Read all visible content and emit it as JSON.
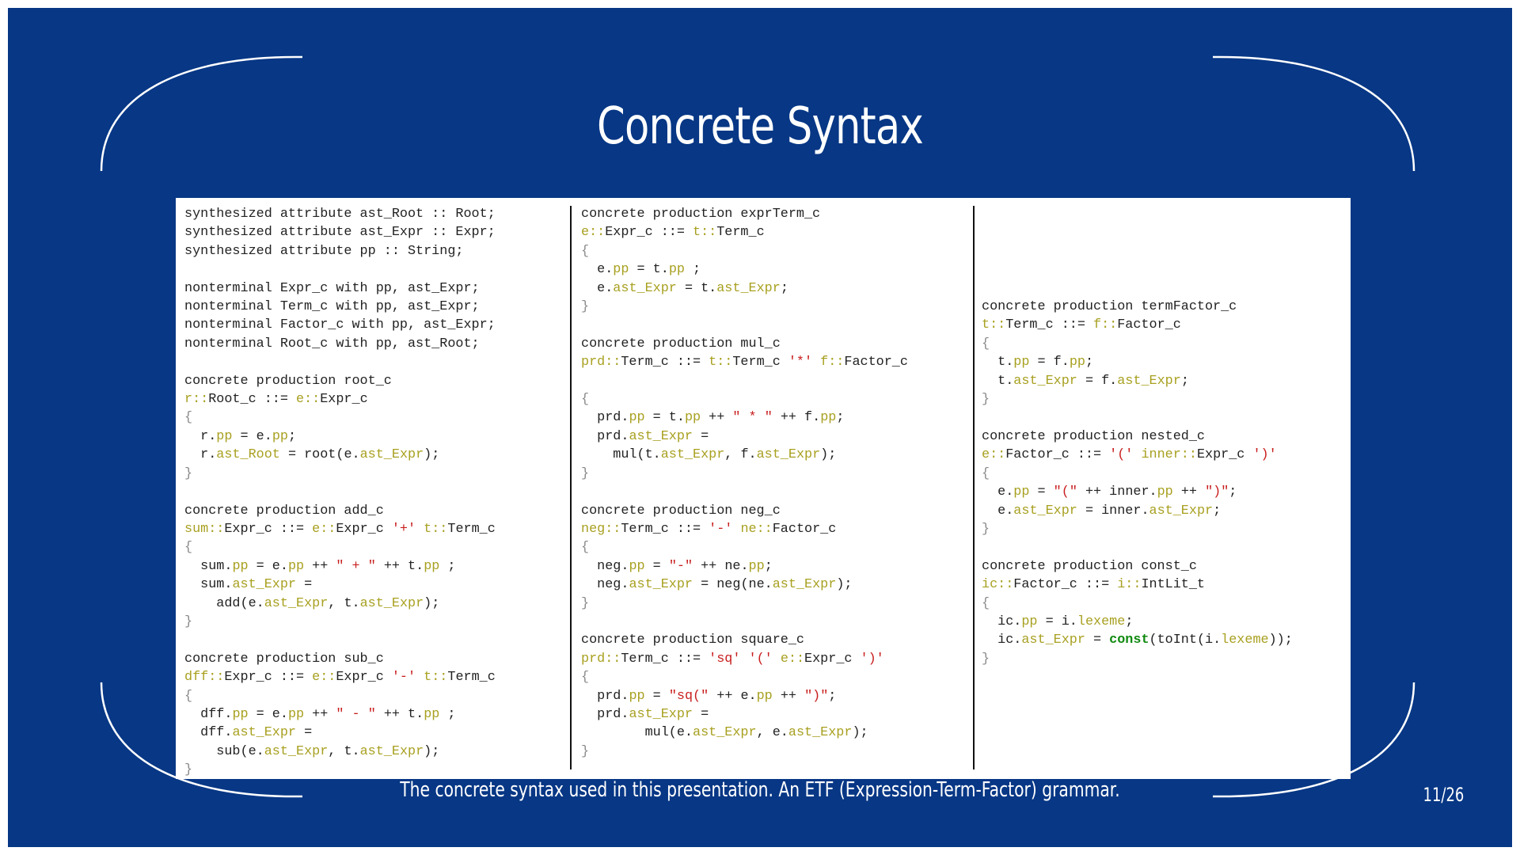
{
  "slide": {
    "title": "Concrete Syntax",
    "caption": "The concrete syntax used in this presentation. An ETF (Expression-Term-Factor) grammar.",
    "page_number": "11/26",
    "background_color": "#073785",
    "frame_color": "#ffffff"
  },
  "code": {
    "colors": {
      "keyword": "#222222",
      "variable": "#a8a020",
      "string": "#c81e1e",
      "brace": "#8a8a8a",
      "constant": "#118a11"
    },
    "columns": [
      [
        [
          [
            "k",
            "synthesized attribute ast_Root :: Root;"
          ]
        ],
        [
          [
            "k",
            "synthesized attribute ast_Expr :: Expr;"
          ]
        ],
        [
          [
            "k",
            "synthesized attribute pp :: String;"
          ]
        ],
        [],
        [
          [
            "k",
            "nonterminal Expr_c with pp, ast_Expr;"
          ]
        ],
        [
          [
            "k",
            "nonterminal Term_c with pp, ast_Expr;"
          ]
        ],
        [
          [
            "k",
            "nonterminal Factor_c with pp, ast_Expr;"
          ]
        ],
        [
          [
            "k",
            "nonterminal Root_c with pp, ast_Root;"
          ]
        ],
        [],
        [
          [
            "k",
            "concrete production root_c"
          ]
        ],
        [
          [
            "v",
            "r::"
          ],
          [
            "k",
            "Root_c ::= "
          ],
          [
            "v",
            "e::"
          ],
          [
            "k",
            "Expr_c"
          ]
        ],
        [
          [
            "b",
            "{"
          ]
        ],
        [
          [
            "k",
            "  r."
          ],
          [
            "v",
            "pp"
          ],
          [
            "k",
            " = e."
          ],
          [
            "v",
            "pp"
          ],
          [
            "k",
            ";"
          ]
        ],
        [
          [
            "k",
            "  r."
          ],
          [
            "v",
            "ast_Root"
          ],
          [
            "k",
            " = root(e."
          ],
          [
            "v",
            "ast_Expr"
          ],
          [
            "k",
            ");"
          ]
        ],
        [
          [
            "b",
            "}"
          ]
        ],
        [],
        [
          [
            "k",
            "concrete production add_c"
          ]
        ],
        [
          [
            "v",
            "sum::"
          ],
          [
            "k",
            "Expr_c ::= "
          ],
          [
            "v",
            "e::"
          ],
          [
            "k",
            "Expr_c "
          ],
          [
            "s",
            "'+'"
          ],
          [
            "k",
            " "
          ],
          [
            "v",
            "t::"
          ],
          [
            "k",
            "Term_c"
          ]
        ],
        [
          [
            "b",
            "{"
          ]
        ],
        [
          [
            "k",
            "  sum."
          ],
          [
            "v",
            "pp"
          ],
          [
            "k",
            " = e."
          ],
          [
            "v",
            "pp"
          ],
          [
            "k",
            " ++ "
          ],
          [
            "s",
            "\" + \""
          ],
          [
            "k",
            " ++ t."
          ],
          [
            "v",
            "pp"
          ],
          [
            "k",
            " ;"
          ]
        ],
        [
          [
            "k",
            "  sum."
          ],
          [
            "v",
            "ast_Expr"
          ],
          [
            "k",
            " ="
          ]
        ],
        [
          [
            "k",
            "    add(e."
          ],
          [
            "v",
            "ast_Expr"
          ],
          [
            "k",
            ", t."
          ],
          [
            "v",
            "ast_Expr"
          ],
          [
            "k",
            ");"
          ]
        ],
        [
          [
            "b",
            "}"
          ]
        ],
        [],
        [
          [
            "k",
            "concrete production sub_c"
          ]
        ],
        [
          [
            "v",
            "dff::"
          ],
          [
            "k",
            "Expr_c ::= "
          ],
          [
            "v",
            "e::"
          ],
          [
            "k",
            "Expr_c "
          ],
          [
            "s",
            "'-'"
          ],
          [
            "k",
            " "
          ],
          [
            "v",
            "t::"
          ],
          [
            "k",
            "Term_c"
          ]
        ],
        [
          [
            "b",
            "{"
          ]
        ],
        [
          [
            "k",
            "  dff."
          ],
          [
            "v",
            "pp"
          ],
          [
            "k",
            " = e."
          ],
          [
            "v",
            "pp"
          ],
          [
            "k",
            " ++ "
          ],
          [
            "s",
            "\" - \""
          ],
          [
            "k",
            " ++ t."
          ],
          [
            "v",
            "pp"
          ],
          [
            "k",
            " ;"
          ]
        ],
        [
          [
            "k",
            "  dff."
          ],
          [
            "v",
            "ast_Expr"
          ],
          [
            "k",
            " ="
          ]
        ],
        [
          [
            "k",
            "    sub(e."
          ],
          [
            "v",
            "ast_Expr"
          ],
          [
            "k",
            ", t."
          ],
          [
            "v",
            "ast_Expr"
          ],
          [
            "k",
            ");"
          ]
        ],
        [
          [
            "b",
            "}"
          ]
        ]
      ],
      [
        [
          [
            "k",
            "concrete production exprTerm_c"
          ]
        ],
        [
          [
            "v",
            "e::"
          ],
          [
            "k",
            "Expr_c ::= "
          ],
          [
            "v",
            "t::"
          ],
          [
            "k",
            "Term_c"
          ]
        ],
        [
          [
            "b",
            "{"
          ]
        ],
        [
          [
            "k",
            "  e."
          ],
          [
            "v",
            "pp"
          ],
          [
            "k",
            " = t."
          ],
          [
            "v",
            "pp"
          ],
          [
            "k",
            " ;"
          ]
        ],
        [
          [
            "k",
            "  e."
          ],
          [
            "v",
            "ast_Expr"
          ],
          [
            "k",
            " = t."
          ],
          [
            "v",
            "ast_Expr"
          ],
          [
            "k",
            ";"
          ]
        ],
        [
          [
            "b",
            "}"
          ]
        ],
        [],
        [
          [
            "k",
            "concrete production mul_c"
          ]
        ],
        [
          [
            "v",
            "prd::"
          ],
          [
            "k",
            "Term_c ::= "
          ],
          [
            "v",
            "t::"
          ],
          [
            "k",
            "Term_c "
          ],
          [
            "s",
            "'*'"
          ],
          [
            "k",
            " "
          ],
          [
            "v",
            "f::"
          ],
          [
            "k",
            "Factor_c"
          ]
        ],
        [],
        [
          [
            "b",
            "{"
          ]
        ],
        [
          [
            "k",
            "  prd."
          ],
          [
            "v",
            "pp"
          ],
          [
            "k",
            " = t."
          ],
          [
            "v",
            "pp"
          ],
          [
            "k",
            " ++ "
          ],
          [
            "s",
            "\" * \""
          ],
          [
            "k",
            " ++ f."
          ],
          [
            "v",
            "pp"
          ],
          [
            "k",
            ";"
          ]
        ],
        [
          [
            "k",
            "  prd."
          ],
          [
            "v",
            "ast_Expr"
          ],
          [
            "k",
            " ="
          ]
        ],
        [
          [
            "k",
            "    mul(t."
          ],
          [
            "v",
            "ast_Expr"
          ],
          [
            "k",
            ", f."
          ],
          [
            "v",
            "ast_Expr"
          ],
          [
            "k",
            ");"
          ]
        ],
        [
          [
            "b",
            "}"
          ]
        ],
        [],
        [
          [
            "k",
            "concrete production neg_c"
          ]
        ],
        [
          [
            "v",
            "neg::"
          ],
          [
            "k",
            "Term_c ::= "
          ],
          [
            "s",
            "'-'"
          ],
          [
            "k",
            " "
          ],
          [
            "v",
            "ne::"
          ],
          [
            "k",
            "Factor_c"
          ]
        ],
        [
          [
            "b",
            "{"
          ]
        ],
        [
          [
            "k",
            "  neg."
          ],
          [
            "v",
            "pp"
          ],
          [
            "k",
            " = "
          ],
          [
            "s",
            "\"-\""
          ],
          [
            "k",
            " ++ ne."
          ],
          [
            "v",
            "pp"
          ],
          [
            "k",
            ";"
          ]
        ],
        [
          [
            "k",
            "  neg."
          ],
          [
            "v",
            "ast_Expr"
          ],
          [
            "k",
            " = neg(ne."
          ],
          [
            "v",
            "ast_Expr"
          ],
          [
            "k",
            ");"
          ]
        ],
        [
          [
            "b",
            "}"
          ]
        ],
        [],
        [
          [
            "k",
            "concrete production square_c"
          ]
        ],
        [
          [
            "v",
            "prd::"
          ],
          [
            "k",
            "Term_c ::= "
          ],
          [
            "s",
            "'sq'"
          ],
          [
            "k",
            " "
          ],
          [
            "s",
            "'('"
          ],
          [
            "k",
            " "
          ],
          [
            "v",
            "e::"
          ],
          [
            "k",
            "Expr_c "
          ],
          [
            "s",
            "')'"
          ]
        ],
        [
          [
            "b",
            "{"
          ]
        ],
        [
          [
            "k",
            "  prd."
          ],
          [
            "v",
            "pp"
          ],
          [
            "k",
            " = "
          ],
          [
            "s",
            "\"sq(\""
          ],
          [
            "k",
            " ++ e."
          ],
          [
            "v",
            "pp"
          ],
          [
            "k",
            " ++ "
          ],
          [
            "s",
            "\")\""
          ],
          [
            "k",
            ";"
          ]
        ],
        [
          [
            "k",
            "  prd."
          ],
          [
            "v",
            "ast_Expr"
          ],
          [
            "k",
            " ="
          ]
        ],
        [
          [
            "k",
            "        mul(e."
          ],
          [
            "v",
            "ast_Expr"
          ],
          [
            "k",
            ", e."
          ],
          [
            "v",
            "ast_Expr"
          ],
          [
            "k",
            ");"
          ]
        ],
        [
          [
            "b",
            "}"
          ]
        ]
      ],
      [
        [],
        [],
        [],
        [],
        [],
        [
          [
            "k",
            "concrete production termFactor_c"
          ]
        ],
        [
          [
            "v",
            "t::"
          ],
          [
            "k",
            "Term_c ::= "
          ],
          [
            "v",
            "f::"
          ],
          [
            "k",
            "Factor_c"
          ]
        ],
        [
          [
            "b",
            "{"
          ]
        ],
        [
          [
            "k",
            "  t."
          ],
          [
            "v",
            "pp"
          ],
          [
            "k",
            " = f."
          ],
          [
            "v",
            "pp"
          ],
          [
            "k",
            ";"
          ]
        ],
        [
          [
            "k",
            "  t."
          ],
          [
            "v",
            "ast_Expr"
          ],
          [
            "k",
            " = f."
          ],
          [
            "v",
            "ast_Expr"
          ],
          [
            "k",
            ";"
          ]
        ],
        [
          [
            "b",
            "}"
          ]
        ],
        [],
        [
          [
            "k",
            "concrete production nested_c"
          ]
        ],
        [
          [
            "v",
            "e::"
          ],
          [
            "k",
            "Factor_c ::= "
          ],
          [
            "s",
            "'('"
          ],
          [
            "k",
            " "
          ],
          [
            "v",
            "inner::"
          ],
          [
            "k",
            "Expr_c "
          ],
          [
            "s",
            "')'"
          ]
        ],
        [
          [
            "b",
            "{"
          ]
        ],
        [
          [
            "k",
            "  e."
          ],
          [
            "v",
            "pp"
          ],
          [
            "k",
            " = "
          ],
          [
            "s",
            "\"(\""
          ],
          [
            "k",
            " ++ inner."
          ],
          [
            "v",
            "pp"
          ],
          [
            "k",
            " ++ "
          ],
          [
            "s",
            "\")\""
          ],
          [
            "k",
            ";"
          ]
        ],
        [
          [
            "k",
            "  e."
          ],
          [
            "v",
            "ast_Expr"
          ],
          [
            "k",
            " = inner."
          ],
          [
            "v",
            "ast_Expr"
          ],
          [
            "k",
            ";"
          ]
        ],
        [
          [
            "b",
            "}"
          ]
        ],
        [],
        [
          [
            "k",
            "concrete production const_c"
          ]
        ],
        [
          [
            "v",
            "ic::"
          ],
          [
            "k",
            "Factor_c ::= "
          ],
          [
            "v",
            "i::"
          ],
          [
            "k",
            "IntLit_t"
          ]
        ],
        [
          [
            "b",
            "{"
          ]
        ],
        [
          [
            "k",
            "  ic."
          ],
          [
            "v",
            "pp"
          ],
          [
            "k",
            " = i."
          ],
          [
            "v",
            "lexeme"
          ],
          [
            "k",
            ";"
          ]
        ],
        [
          [
            "k",
            "  ic."
          ],
          [
            "v",
            "ast_Expr"
          ],
          [
            "k",
            " = "
          ],
          [
            "c",
            "const"
          ],
          [
            "k",
            "(toInt(i."
          ],
          [
            "v",
            "lexeme"
          ],
          [
            "k",
            "));"
          ]
        ],
        [
          [
            "b",
            "}"
          ]
        ]
      ]
    ]
  }
}
